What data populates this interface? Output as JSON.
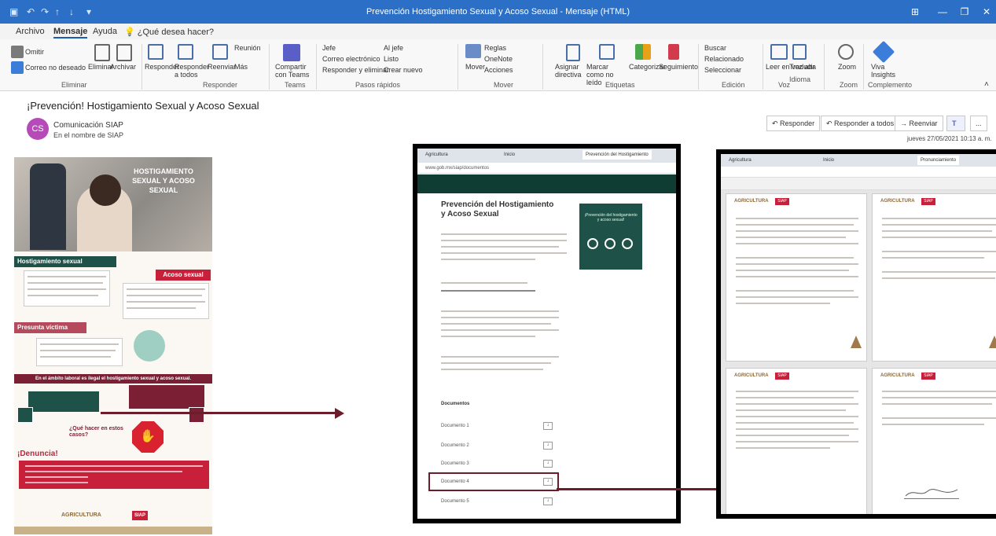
{
  "window": {
    "title": "Prevención Hostigamiento Sexual y Acoso Sexual - Mensaje (HTML)",
    "controls": [
      "—",
      "❐",
      "✕"
    ]
  },
  "tabs": [
    {
      "label": "Archivo"
    },
    {
      "label": "Mensaje"
    },
    {
      "label": "Ayuda"
    },
    {
      "label": "¿Qué desea hacer?"
    }
  ],
  "ribbon": {
    "groups": [
      {
        "name": "Eliminar",
        "buttons": [
          "Omitir",
          "Correo no deseado",
          "Eliminar",
          "Archivar"
        ]
      },
      {
        "name": "Responder",
        "buttons": [
          "Responder",
          "Responder a todos",
          "Reenviar",
          "Reunión",
          "Más"
        ]
      },
      {
        "name": "Teams",
        "buttons": [
          "Compartir con Teams"
        ]
      },
      {
        "name": "Pasos rápidos",
        "buttons": [
          "Jefe",
          "Correo electrónico",
          "Responder y eliminar",
          "Al jefe",
          "Listo",
          "Crear nuevo"
        ]
      },
      {
        "name": "Mover",
        "buttons": [
          "Mover",
          "Reglas",
          "OneNote",
          "Acciones"
        ]
      },
      {
        "name": "Etiquetas",
        "buttons": [
          "Asignar directiva",
          "Marcar como no leído",
          "Categorizar",
          "Seguimiento"
        ]
      },
      {
        "name": "Edición",
        "buttons": [
          "Buscar",
          "Relacionado",
          "Seleccionar"
        ]
      },
      {
        "name": "Voz",
        "buttons": [
          "Leer en voz alta"
        ]
      },
      {
        "name": "Idioma",
        "buttons": [
          "Traducir"
        ]
      },
      {
        "name": "Zoom",
        "buttons": [
          "Zoom"
        ]
      },
      {
        "name": "Complemento",
        "buttons": [
          "Viva Insights"
        ]
      }
    ]
  },
  "message": {
    "subject": "¡Prevención! Hostigamiento Sexual y Acoso Sexual",
    "avatar_initials": "CS",
    "sender": "Comunicación SIAP",
    "on_behalf": "En el nombre de SIAP",
    "actions": [
      "Responder",
      "Responder a todos",
      "Reenviar",
      "Teams",
      "..."
    ],
    "date": "jueves 27/05/2021 10:13 a. m."
  },
  "infographic": {
    "header_title": "HOSTIGAMIENTO SEXUAL Y ACOSO SEXUAL",
    "hostigamiento_heading": "Hostigamiento sexual",
    "acoso_heading": "Acoso sexual",
    "victima_heading": "Presunta víctima",
    "banner": "En el ámbito laboral es ilegal el hostigamiento sexual y acoso sexual.",
    "question": "¿Qué hacer en estos casos?",
    "denuncia_heading": "¡Denuncia!",
    "footer_logos": [
      "AGRICULTURA",
      "SIAP"
    ]
  },
  "browser_panel": {
    "tabs": [
      "Agricultura",
      "Inicio",
      "Prevención del Hostigamiento"
    ],
    "address": "www.gob.mx/siap/documentos",
    "page_title": "Prevención del Hostigamiento y Acoso Sexual",
    "card_title": "¡Prevención del hostigamiento y acoso sexual!",
    "section": "Documentos",
    "documents": [
      "Documento 1",
      "Documento 2",
      "Documento 3",
      "Documento 4",
      "Documento 5"
    ]
  },
  "pdf_panel": {
    "tabs": [
      "Agricultura",
      "Inicio",
      "Pronunciamiento"
    ],
    "header_logos": [
      "AGRICULTURA",
      "SIAP"
    ]
  },
  "colors": {
    "titlebar": "#2b6fc7",
    "wine": "#7b1f34",
    "red": "#c8203a",
    "green": "#1e5147"
  }
}
